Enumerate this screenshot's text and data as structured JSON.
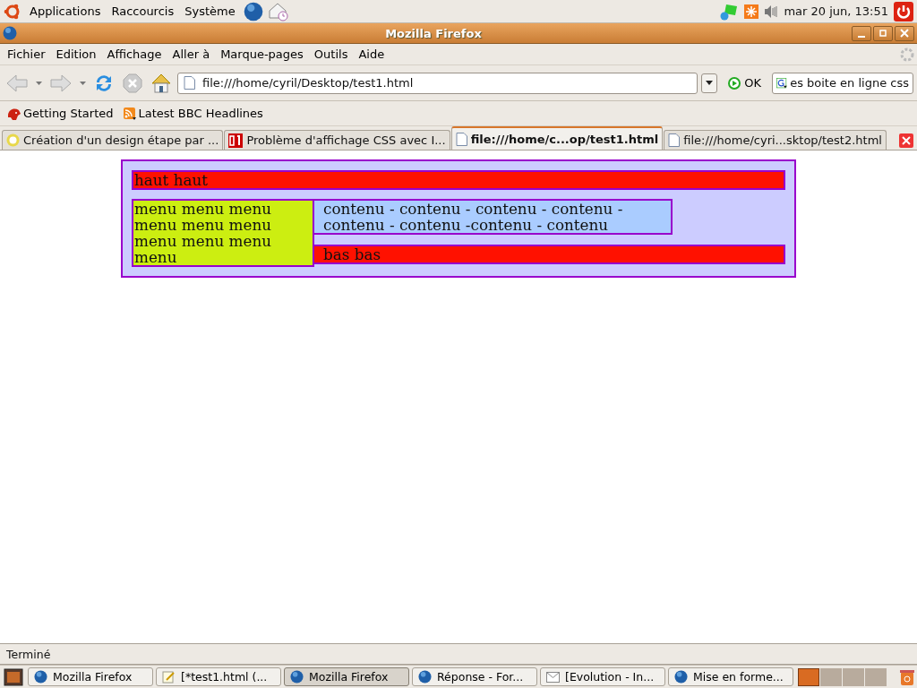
{
  "top_panel": {
    "menus": [
      "Applications",
      "Raccourcis",
      "Système"
    ],
    "clock": "mar 20 jun, 13:51"
  },
  "window": {
    "title": "Mozilla Firefox"
  },
  "menu_bar": [
    "Fichier",
    "Edition",
    "Affichage",
    "Aller à",
    "Marque-pages",
    "Outils",
    "Aide"
  ],
  "toolbar": {
    "url": "file:///home/cyril/Desktop/test1.html",
    "go_label": "OK",
    "search_value": "es boite en ligne css"
  },
  "bookmarks": [
    {
      "label": "Getting Started",
      "kind": "firefox"
    },
    {
      "label": "Latest BBC Headlines",
      "kind": "feed"
    }
  ],
  "tabs": [
    {
      "label": "Création d'un design étape par ...",
      "selected": false,
      "kind": "site"
    },
    {
      "label": "Problème d'affichage CSS avec I...",
      "selected": false,
      "kind": "news"
    },
    {
      "label": "file:///home/c...op/test1.html",
      "selected": true,
      "kind": "file"
    },
    {
      "label": "file:///home/cyri...sktop/test2.html",
      "selected": false,
      "kind": "file"
    }
  ],
  "page": {
    "header": "haut haut",
    "menu": "menu menu menu menu menu menu menu menu menu menu",
    "content": "contenu - contenu - contenu - contenu -contenu - contenu -contenu - contenu",
    "footer": "bas bas"
  },
  "status_bar": "Terminé",
  "taskbar": {
    "tasks": [
      {
        "label": "Mozilla Firefox",
        "selected": false,
        "kind": "browser"
      },
      {
        "label": "[*test1.html (...",
        "selected": false,
        "kind": "editor"
      },
      {
        "label": "Mozilla Firefox",
        "selected": true,
        "kind": "browser"
      },
      {
        "label": "Réponse - For...",
        "selected": false,
        "kind": "browser"
      },
      {
        "label": "[Evolution - In...",
        "selected": false,
        "kind": "mail"
      },
      {
        "label": "Mise en forme...",
        "selected": false,
        "kind": "browser"
      }
    ],
    "workspaces": [
      {
        "selected": true
      },
      {
        "selected": false
      },
      {
        "selected": false
      },
      {
        "selected": false
      }
    ]
  }
}
